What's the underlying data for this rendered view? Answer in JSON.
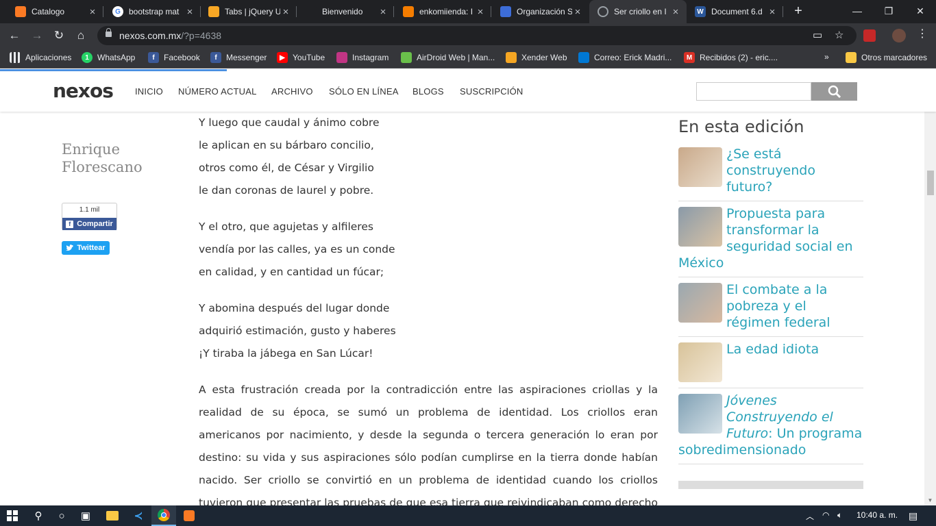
{
  "browser": {
    "tabs": [
      {
        "title": "Catalogo",
        "fav": "xampp-icon",
        "color": "#fb7a24"
      },
      {
        "title": "bootstrap mat",
        "fav": "google-icon",
        "color": "#ffffff"
      },
      {
        "title": "Tabs | jQuery U",
        "fav": "jquery-icon",
        "color": "#f9a825"
      },
      {
        "title": "Bienvenido",
        "fav": "batman-icon",
        "color": "#202124"
      },
      {
        "title": "enkomiienda: I",
        "fav": "blogger-icon",
        "color": "#f57d00"
      },
      {
        "title": "Organización S",
        "fav": "globe-icon",
        "color": "#3d6dd8"
      },
      {
        "title": "Ser criollo en I",
        "fav": "loading-icon",
        "color": "#5f6368"
      },
      {
        "title": "Document 6.d",
        "fav": "word-icon",
        "color": "#2b579a"
      }
    ],
    "url": {
      "host": "nexos.com.mx",
      "path": "/?p=4638"
    },
    "bookmarks": [
      {
        "label": "Aplicaciones",
        "icon": "apps-icon",
        "color": "#4285f4"
      },
      {
        "label": "WhatsApp",
        "icon": "whatsapp-icon",
        "color": "#25d366"
      },
      {
        "label": "Facebook",
        "icon": "facebook-icon",
        "color": "#3b5998"
      },
      {
        "label": "Messenger",
        "icon": "facebook-icon",
        "color": "#3b5998"
      },
      {
        "label": "YouTube",
        "icon": "youtube-icon",
        "color": "#ff0000"
      },
      {
        "label": "Instagram",
        "icon": "instagram-icon",
        "color": "#c13584"
      },
      {
        "label": "AirDroid Web | Man...",
        "icon": "airdroid-icon",
        "color": "#6abf4b"
      },
      {
        "label": "Xender Web",
        "icon": "xender-icon",
        "color": "#f5a623"
      },
      {
        "label": "Correo: Erick Madri...",
        "icon": "outlook-icon",
        "color": "#0078d4"
      },
      {
        "label": "Recibidos (2) - eric....",
        "icon": "gmail-icon",
        "color": "#d93025"
      }
    ],
    "other_bookmarks": "Otros marcadores",
    "chevrons": "»"
  },
  "site": {
    "logo": "nexos",
    "menu": [
      "INICIO",
      "NÚMERO ACTUAL",
      "ARCHIVO",
      "SÓLO EN LÍNEA",
      "BLOGS",
      "SUSCRIPCIÓN"
    ],
    "author": "Enrique Florescano",
    "share_count": "1.1 mil",
    "share_label": "Compartir",
    "tweet_label": "Twittear",
    "stanzas": [
      [
        "Y luego que caudal y ánimo cobre",
        "le aplican en su bárbaro concilio,",
        "otros como él, de César y Virgilio",
        "le dan coronas de laurel y pobre."
      ],
      [
        "Y el otro, que agujetas y alfileres",
        "vendía por las calles, ya es un conde",
        "en calidad, y en cantidad un fúcar;"
      ],
      [
        "Y abomina después del lugar donde",
        "adquirió estimación, gusto y haberes",
        "¡Y tiraba la jábega en San Lúcar!"
      ]
    ],
    "paragraph": "A esta frustración creada por la contradicción entre las aspiraciones criollas y la realidad de su época, se sumó un problema de identidad. Los criollos eran americanos por nacimiento, y desde la segunda o tercera generación lo eran por destino: su vida y sus aspiraciones sólo podían cumplirse en la tierra donde habían nacido. Ser criollo se convirtió en un problema de identidad cuando los criollos tuvieron que presentar las pruebas de que esa tierra que reivindicaban como derecho de herencia era verdaderamente propia. La conciencia criolla",
    "sidebar_title": "En esta edición",
    "sidebar_items": [
      {
        "title": "¿Se está construyendo futuro?"
      },
      {
        "title": "Propuesta para transformar la seguridad social en México"
      },
      {
        "title": "El combate a la pobreza y el régimen federal"
      },
      {
        "title": "La edad idiota"
      },
      {
        "title_italic": "Jóvenes Construyendo el Futuro",
        "title_rest": ": Un programa sobredimensionado"
      }
    ]
  },
  "taskbar": {
    "time": "10:40 a. m."
  },
  "accent": "#2aa3b9"
}
